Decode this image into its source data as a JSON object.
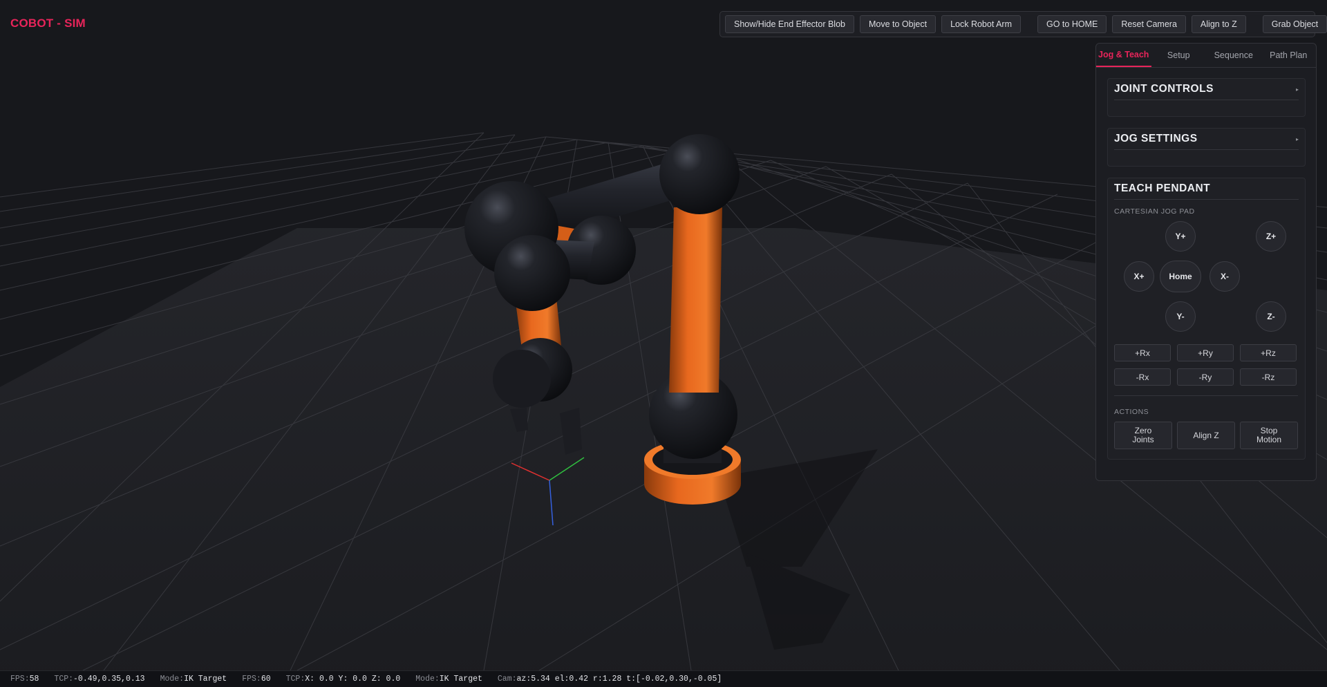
{
  "app": {
    "title": "COBOT - SIM"
  },
  "toolbar": {
    "group1": [
      "Show/Hide End Effector Blob",
      "Move to Object",
      "Lock Robot Arm"
    ],
    "group2": [
      "GO to HOME",
      "Reset Camera",
      "Align to Z"
    ],
    "group3": [
      "Grab Object"
    ]
  },
  "panel": {
    "tabs": [
      "Jog & Teach",
      "Setup",
      "Sequence",
      "Path Plan"
    ],
    "active_tab": "Jog & Teach",
    "joint_controls": {
      "title": "JOINT CONTROLS"
    },
    "jog_settings": {
      "title": "JOG SETTINGS"
    },
    "teach_pendant": {
      "title": "TEACH PENDANT",
      "jog_pad_label": "CARTESIAN JOG PAD",
      "jog_pad": {
        "y_plus": "Y+",
        "z_plus": "Z+",
        "x_plus": "X+",
        "home": "Home",
        "x_minus": "X-",
        "y_minus": "Y-",
        "z_minus": "Z-"
      },
      "rotation": [
        "+Rx",
        "+Ry",
        "+Rz",
        "-Rx",
        "-Ry",
        "-Rz"
      ],
      "actions_label": "ACTIONS",
      "actions": [
        "Zero Joints",
        "Align Z",
        "Stop Motion"
      ]
    }
  },
  "status": {
    "fps1_k": "FPS:",
    "fps1_v": "58",
    "tcp1_k": "TCP:",
    "tcp1_v": "-0.49,0.35,0.13",
    "mode1_k": "Mode:",
    "mode1_v": "IK Target",
    "fps2_k": "FPS:",
    "fps2_v": "60",
    "tcp2_k": "TCP:",
    "tcp2_v": "X: 0.0 Y: 0.0 Z: 0.0",
    "mode2_k": "Mode:",
    "mode2_v": "IK Target",
    "cam_k": "Cam:",
    "cam_v": "az:5.34 el:0.42 r:1.28 t:[-0.02,0.30,-0.05]"
  },
  "colors": {
    "accent": "#e8245a",
    "robot_orange": "#e8661c",
    "robot_dark": "#1e1f24"
  }
}
